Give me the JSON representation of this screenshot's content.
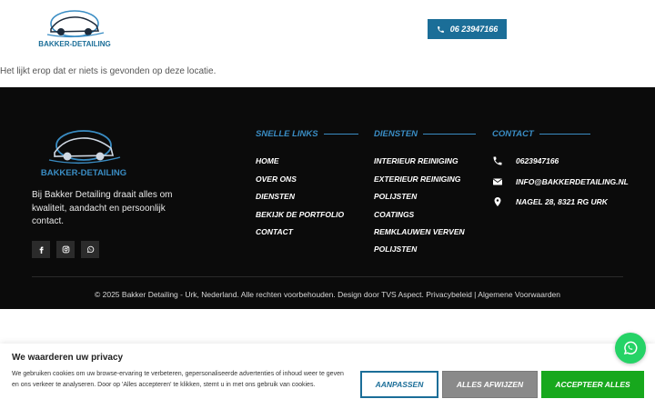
{
  "header": {
    "logo_text": "BAKKER-DETAILING",
    "phone_label": "06 23947166"
  },
  "main": {
    "not_found_text": "Het lijkt erop dat er niets is gevonden op deze locatie."
  },
  "footer": {
    "logo_text": "BAKKER-DETAILING",
    "about": "Bij Bakker Detailing draait alles om kwaliteit, aandacht en persoonlijk contact.",
    "social": [
      "facebook-icon",
      "instagram-icon",
      "whatsapp-icon"
    ],
    "quick_links": {
      "title": "SNELLE LINKS",
      "items": [
        "HOME",
        "OVER ONS",
        "DIENSTEN",
        "BEKIJK DE PORTFOLIO",
        "CONTACT"
      ]
    },
    "services": {
      "title": "DIENSTEN",
      "items": [
        "INTERIEUR REINIGING",
        "EXTERIEUR REINIGING",
        "POLIJSTEN",
        "COATINGS",
        "REMKLAUWEN VERVEN",
        "POLIJSTEN"
      ]
    },
    "contact": {
      "title": "CONTACT",
      "phone": "0623947166",
      "email": "INFO@BAKKERDETAILING.NL",
      "address": "NAGEL 28, 8321 RG URK"
    },
    "copyright": "© 2025 Bakker Detailing - Urk, Nederland. Alle rechten voorbehouden. Design door TVS Aspect. Privacybeleid | Algemene Voorwaarden"
  },
  "cookie": {
    "title": "We waarderen uw privacy",
    "text": "We gebruiken cookies om uw browse-ervaring te verbeteren, gepersonaliseerde advertenties of inhoud weer te geven en ons verkeer te analyseren. Door op 'Alles accepteren' te klikken, stemt u in met ons gebruik van cookies.",
    "customize_label": "AANPASSEN",
    "reject_label": "ALLES AFWIJZEN",
    "accept_label": "ACCEPTEER ALLES"
  },
  "colors": {
    "brand_blue": "#1b6e98",
    "accent_blue": "#3a8dc4",
    "footer_bg": "#0b0b0b",
    "accept_green": "#17a81d",
    "whatsapp_green": "#25d366"
  }
}
